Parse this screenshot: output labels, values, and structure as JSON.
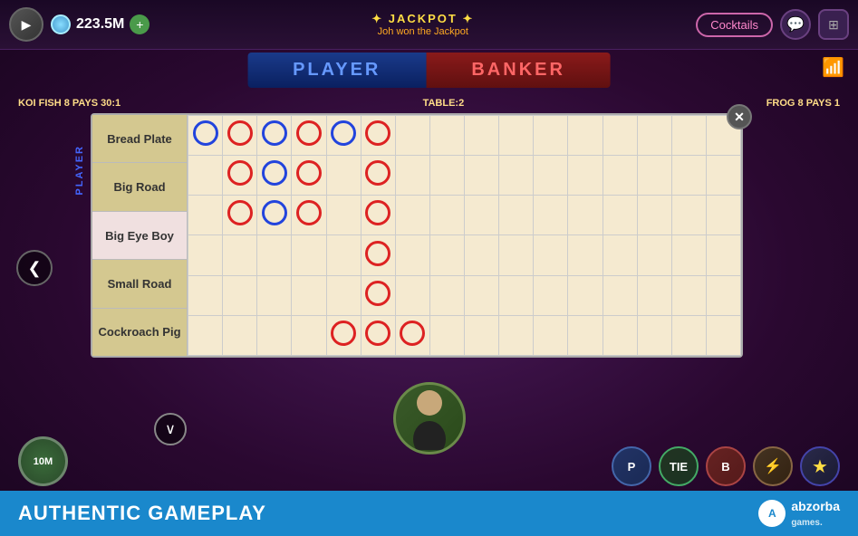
{
  "topBar": {
    "coinAmount": "223.5M",
    "playBtn": "▶",
    "plusBtn": "+",
    "jackpotTitle": "✦ JACKPOT ✦",
    "jackpotSubtitle": "Joh won the Jackpot",
    "cocktailsBtn": "Cocktails",
    "chatIcon": "💬",
    "gridIcon": "⊞"
  },
  "table": {
    "playerLabel": "PLAYER",
    "bankerLabel": "BANKER",
    "statsLeft": "KOI FISH 8 PAYS 30:1",
    "statsCenter": "TABLE:2",
    "statsRight": "FROG 8 PAYS 1",
    "sideLabel": "PLAYER"
  },
  "scoreboard": {
    "closeBtn": "✕",
    "roads": [
      {
        "label": "Bread Plate",
        "active": false
      },
      {
        "label": "Big Road",
        "active": false
      },
      {
        "label": "Big Eye Boy",
        "active": true
      },
      {
        "label": "Small Road",
        "active": false
      },
      {
        "label": "Cockroach Pig",
        "active": false
      }
    ],
    "grid": {
      "rows": 6,
      "cols": 16
    }
  },
  "gameButtons": {
    "player": "P",
    "tie": "TIE",
    "banker": "B",
    "special1": "⚡",
    "special2": "⚡"
  },
  "bottomBar": {
    "authenticText": "AUTHENTIC GAMEPLAY",
    "abzorbaText": "abzorba",
    "abzorbaGames": "games."
  },
  "navArrows": {
    "left": "❮",
    "right": "❯",
    "down": "⌄"
  },
  "chips": {
    "chip10m": "10M"
  },
  "starBtn": "★"
}
